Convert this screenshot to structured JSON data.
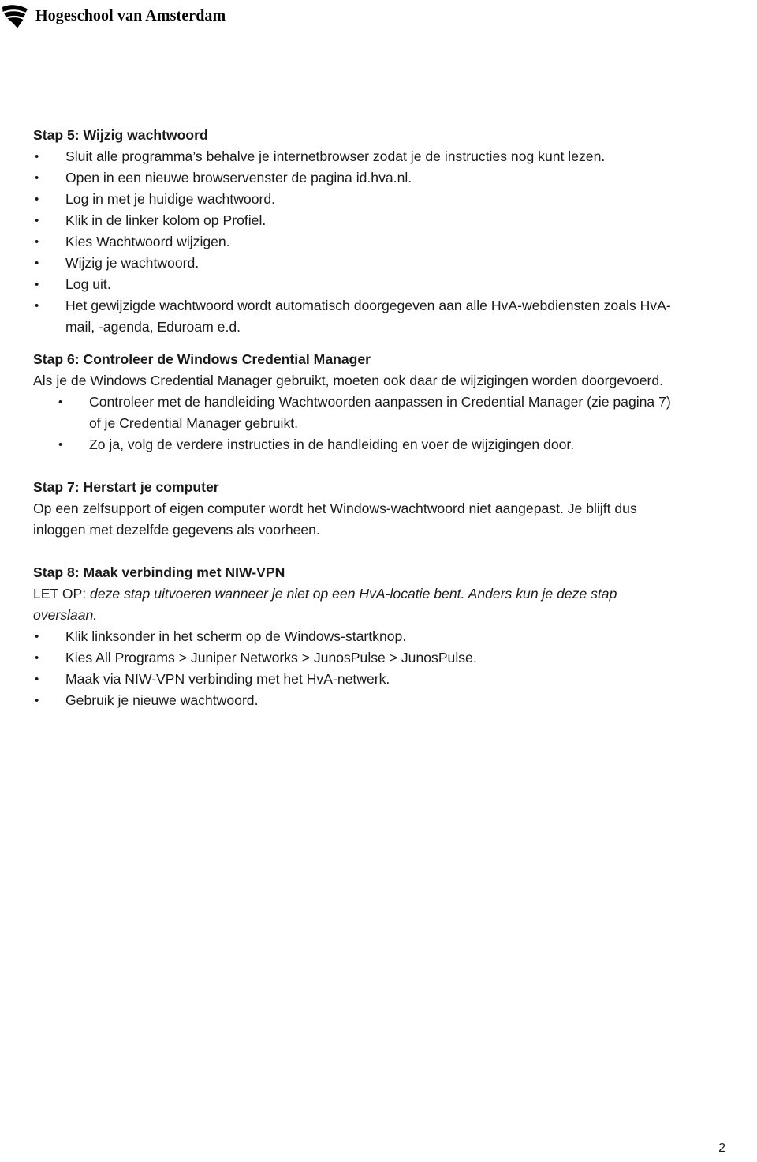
{
  "header": {
    "logo_icon": "hva-shield-logo-icon",
    "title": "Hogeschool van Amsterdam"
  },
  "bullet_glyph": "•",
  "sections": {
    "stap5": {
      "heading": "Stap 5: Wijzig wachtwoord",
      "bullets": [
        "Sluit alle programma’s behalve je internetbrowser zodat je de instructies nog kunt lezen.",
        "Open in een nieuwe browservenster de pagina id.hva.nl.",
        "Log in met je huidige wachtwoord.",
        "Klik in de linker kolom op Profiel.",
        "Kies Wachtwoord wijzigen.",
        "Wijzig je wachtwoord.",
        "Log uit.",
        "Het gewijzigde wachtwoord wordt automatisch doorgegeven aan alle HvA-webdiensten zoals HvA-mail, -agenda, Eduroam e.d."
      ]
    },
    "stap6": {
      "heading": "Stap 6: Controleer de Windows Credential Manager",
      "intro": "Als je de Windows Credential Manager gebruikt, moeten ook daar de wijzigingen worden doorgevoerd.",
      "bullets": [
        "Controleer met de handleiding Wachtwoorden aanpassen in Credential Manager (zie pagina 7) of je Credential Manager gebruikt.",
        "Zo ja, volg de verdere instructies in de handleiding en voer de wijzigingen door."
      ]
    },
    "stap7": {
      "heading": "Stap 7: Herstart je computer",
      "intro": "Op een zelfsupport of eigen computer wordt het Windows-wachtwoord niet aangepast. Je blijft dus inloggen met dezelfde gegevens als voorheen."
    },
    "stap8": {
      "heading": "Stap 8: Maak verbinding met NIW-VPN",
      "note_prefix": "LET OP: ",
      "note_italic": "deze stap uitvoeren wanneer je niet op een HvA-locatie bent. Anders kun je deze stap overslaan.",
      "bullets": [
        "Klik linksonder in het scherm op de Windows-startknop.",
        "Kies All Programs > Juniper Networks > JunosPulse > JunosPulse.",
        "Maak via NIW-VPN verbinding met het HvA-netwerk.",
        "Gebruik je nieuwe wachtwoord."
      ]
    }
  },
  "footer": {
    "page_number": "2"
  }
}
